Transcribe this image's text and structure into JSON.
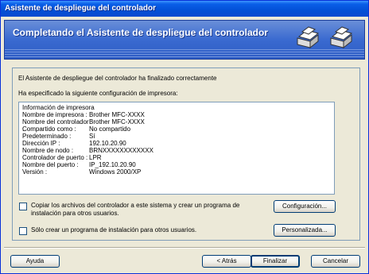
{
  "window": {
    "title": "Asistente de despliegue del controlador"
  },
  "banner": {
    "title": "Completando el Asistente de despliegue del controlador",
    "icon": "printer-icon"
  },
  "intro": {
    "line1": "El Asistente de despliegue del controlador ha finalizado correctamente",
    "line2": "Ha especificado la siguiente configuración de impresora:"
  },
  "info": {
    "heading": "Información de impresora",
    "rows": [
      {
        "key": "Nombre de impresora :",
        "value": "Brother MFC-XXXX"
      },
      {
        "key": "Nombre del controlador :",
        "value": "Brother MFC-XXXX"
      },
      {
        "key": "Compartido como :",
        "value": "No compartido"
      },
      {
        "key": "Predeterminado :",
        "value": "Sí"
      },
      {
        "key": "Dirección IP :",
        "value": "192.10.20.90"
      },
      {
        "key": "Nombre de nodo :",
        "value": "BRNXXXXXXXXXXXX"
      },
      {
        "key": "Controlador de puerto :",
        "value": "LPR"
      },
      {
        "key": "Nombre del puerto :",
        "value": "IP_192.10.20.90"
      },
      {
        "key": "Versión :",
        "value": "Windows 2000/XP"
      }
    ]
  },
  "options": {
    "copy_label": "Copiar los archivos del controlador a este sistema y crear un programa de instalación para otros usuarios.",
    "installer_only_label": "Sólo crear un programa de instalación para otros usuarios.",
    "copy_checked": false,
    "installer_only_checked": false
  },
  "buttons": {
    "config": "Configuración...",
    "custom": "Personalizada...",
    "help": "Ayuda",
    "back": "< Atrás",
    "finish": "Finalizar",
    "cancel": "Cancelar"
  }
}
